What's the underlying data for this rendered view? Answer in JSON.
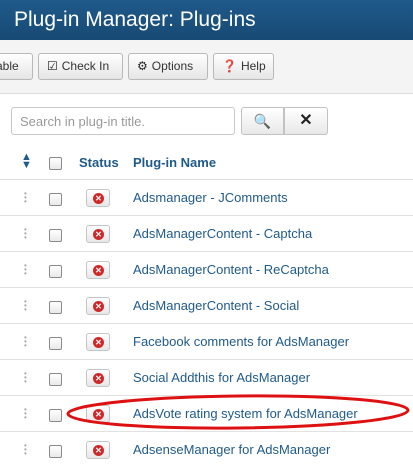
{
  "header": {
    "title": "Plug-in Manager: Plug-ins"
  },
  "toolbar": {
    "first_label": "able",
    "checkin_label": "Check In",
    "options_label": "Options",
    "help_label": "Help"
  },
  "search": {
    "placeholder": "Search in plug-in title."
  },
  "table": {
    "headers": {
      "status": "Status",
      "name": "Plug-in Name"
    },
    "rows": [
      {
        "name": "Adsmanager - JComments",
        "status": "disabled"
      },
      {
        "name": "AdsManagerContent - Captcha",
        "status": "disabled"
      },
      {
        "name": "AdsManagerContent - ReCaptcha",
        "status": "disabled"
      },
      {
        "name": "AdsManagerContent - Social",
        "status": "disabled"
      },
      {
        "name": "Facebook comments for AdsManager",
        "status": "disabled"
      },
      {
        "name": "Social Addthis for AdsManager",
        "status": "disabled"
      },
      {
        "name": "AdsVote rating system for AdsManager",
        "status": "disabled"
      },
      {
        "name": "AdsenseManager for AdsManager",
        "status": "disabled"
      }
    ]
  },
  "colors": {
    "header_bg": "#1f5a8a",
    "link": "#1f5a8a",
    "status_disabled": "#cc2a2a",
    "annotation": "#dd1111"
  }
}
